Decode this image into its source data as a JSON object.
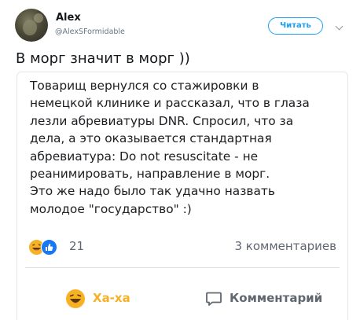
{
  "header": {
    "author_name": "Alex",
    "author_handle": "@AlexSFormidable",
    "follow_label": "Читать"
  },
  "tweet": {
    "text": "В морг значит в морг ))"
  },
  "card": {
    "body": "Товарищ вернулся со стажировки в\nнемецкой клинике и рассказал, что в глаза\nлезли абревиатуры DNR. Спросил, что за\nдела, а это оказывается стандартная\nабревиатура: Do not resuscitate - не\nреанимировать, направление в морг.\nЭто же надо было так удачно назвать\nмолодое \"государство\" :)",
    "reaction_count": "21",
    "comments_count": "3 комментариев",
    "reactions": [
      "haha-icon",
      "like-icon"
    ],
    "actions": {
      "haha_label": "Ха-ха",
      "comment_label": "Комментарий"
    }
  },
  "colors": {
    "twitter_blue": "#1da1f2",
    "haha_yellow": "#f7b125",
    "like_blue": "#1877f2",
    "secondary_text": "#606770"
  }
}
